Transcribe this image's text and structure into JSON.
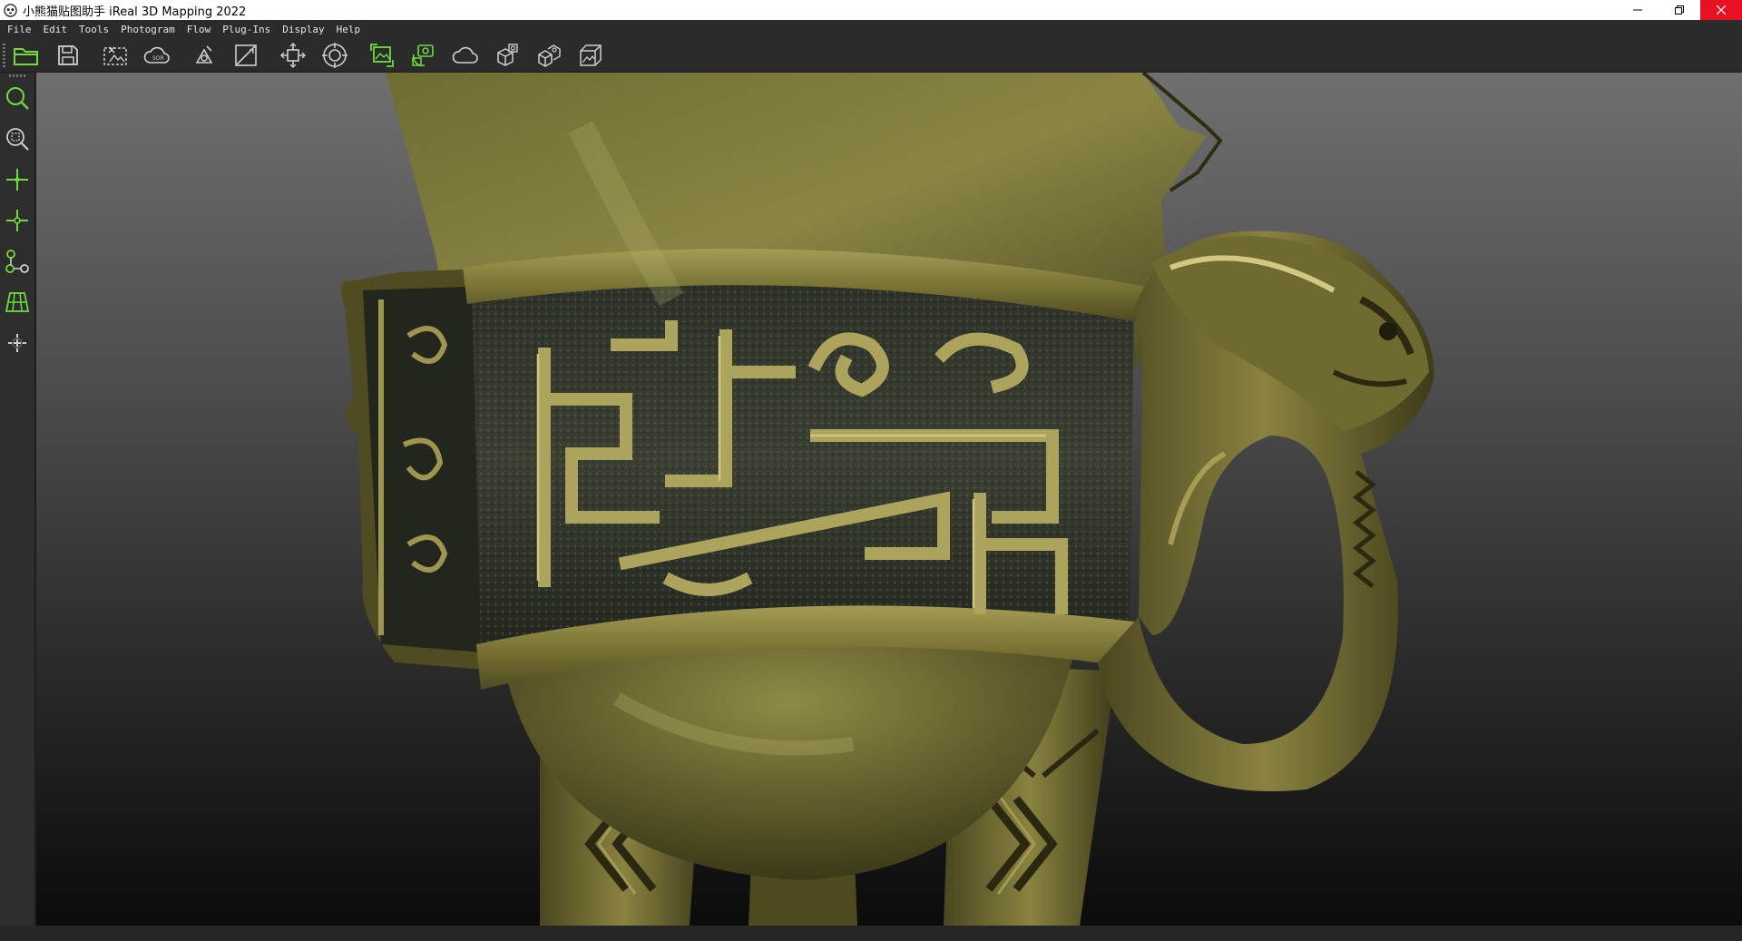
{
  "window": {
    "title": "小熊猫贴图助手 iReal 3D Mapping 2022",
    "controls": [
      "minimize-icon",
      "restore-icon",
      "close-icon"
    ],
    "close_color": "#e81123"
  },
  "menu": {
    "items": [
      "File",
      "Edit",
      "Tools",
      "Photogram",
      "Flow",
      "Plug-Ins",
      "Display",
      "Help"
    ]
  },
  "toolbar": {
    "icons": [
      "open-folder-icon",
      "save-icon",
      "crop-selection-icon",
      "sor-cloud-icon",
      "clean-tool-icon",
      "diagonal-split-icon",
      "move-model-icon",
      "target-center-icon",
      "photo-align-icon",
      "camera-refresh-icon",
      "cloud-icon",
      "export-model-icon",
      "export-scene-icon",
      "texture-view-icon"
    ],
    "accent_color": "#6ddc3c"
  },
  "left_toolbar": {
    "icons": [
      "zoom-icon",
      "zoom-fit-icon",
      "add-point-icon",
      "pick-point-icon",
      "connect-nodes-icon",
      "grid-icon",
      "pan-cross-icon"
    ]
  },
  "viewport": {
    "content": "3d-textured-bronze-jue-model",
    "background_top": "#6f6f6f",
    "background_bottom": "#0b0b0b"
  }
}
